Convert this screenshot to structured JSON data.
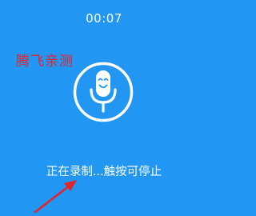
{
  "recorder": {
    "elapsed_time": "00:07",
    "status_text": "正在录制...触按可停止",
    "button_icon": "microphone-smiley-icon"
  },
  "watermark": {
    "text": "腾飞亲测"
  },
  "colors": {
    "background": "#2196F3",
    "foreground": "#FFFFFF",
    "annotation": "#E0262B"
  }
}
